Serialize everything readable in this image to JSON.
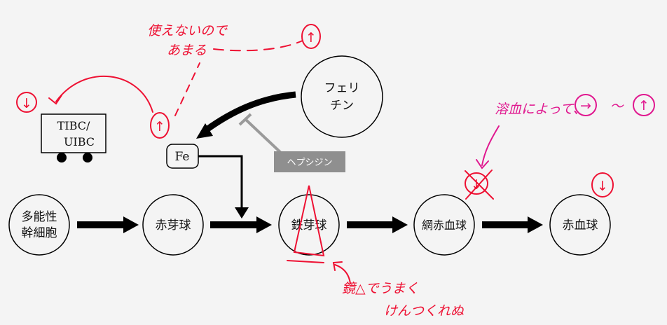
{
  "nodes": {
    "stem_cell": [
      "多能性",
      "幹細胞"
    ],
    "proerythroblast": "赤芽球",
    "sideroblast": "鉄芽球",
    "reticulocyte": "網赤血球",
    "erythrocyte": "赤血球",
    "ferritin": [
      "フェリ",
      "チン"
    ],
    "fe": "Fe",
    "tibc": [
      "TIBC/",
      "UIBC"
    ],
    "hepcidin": "ヘプシジン"
  },
  "annotations": {
    "unusable": [
      "使えないので",
      "あまる"
    ],
    "hemolysis": "溶血によって、",
    "hemolysis_tail": "〜",
    "ring": [
      "鏡△でうまく",
      "けんつくれぬ"
    ]
  },
  "colors": {
    "black": "#000000",
    "red": "#ee1133",
    "magenta": "#e0178f",
    "hepcidin_box": "#8f8f8f",
    "inhibit_line": "#9a9a9a"
  },
  "icons": {
    "down_in_circle": "↓",
    "up_in_circle": "↑",
    "right_in_circle": "→"
  }
}
